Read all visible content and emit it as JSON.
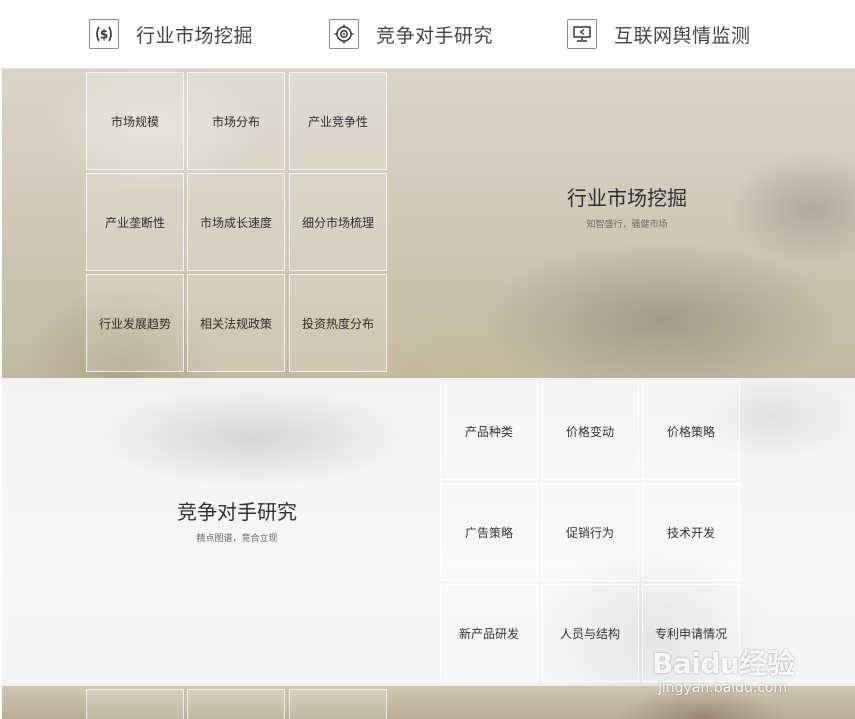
{
  "nav": {
    "items": [
      {
        "label": "行业市场挖掘",
        "icon": "dollar-icon"
      },
      {
        "label": "竞争对手研究",
        "icon": "target-icon"
      },
      {
        "label": "互联网舆情监测",
        "icon": "monitor-icon"
      }
    ]
  },
  "section1": {
    "title": "行业市场挖掘",
    "subtitle": "知智盛行，骚健市场",
    "tiles": [
      "市场规模",
      "市场分布",
      "产业竞争性",
      "产业垄断性",
      "市场成长速度",
      "细分市场梳理",
      "行业发展趋势",
      "相关法规政策",
      "投资热度分布"
    ]
  },
  "section2": {
    "title": "竞争对手研究",
    "subtitle": "精点图谱，竞合立现",
    "tiles": [
      "产品种类",
      "价格变动",
      "价格策略",
      "广告策略",
      "促销行为",
      "技术开发",
      "新产品研发",
      "人员与结构",
      "专利申请情况"
    ]
  },
  "watermark": {
    "brand": "Baidu经验",
    "url": "jingyan.baidu.com"
  }
}
